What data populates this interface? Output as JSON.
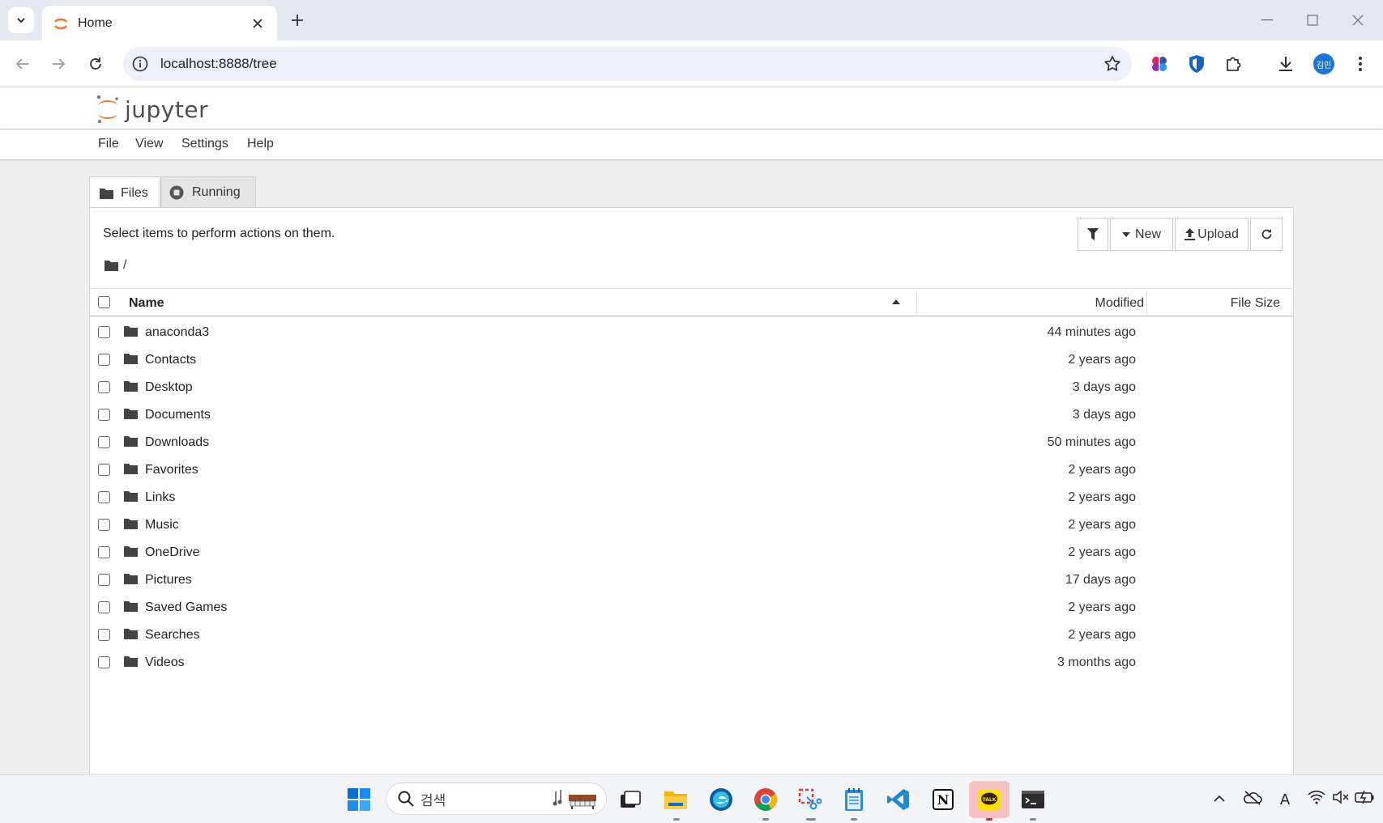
{
  "browser": {
    "tab_title": "Home",
    "url": "localhost:8888/tree",
    "profile_label": "김민"
  },
  "jupyter": {
    "logo_text": "jupyter",
    "menu": [
      "File",
      "View",
      "Settings",
      "Help"
    ],
    "tabs": [
      {
        "label": "Files",
        "icon": "folder-icon",
        "active": true
      },
      {
        "label": "Running",
        "icon": "stop-circle-icon",
        "active": false
      }
    ],
    "hint": "Select items to perform actions on them.",
    "buttons": {
      "filter_icon": "filter-icon",
      "new_label": "New",
      "upload_label": "Upload",
      "refresh_icon": "refresh-icon"
    },
    "breadcrumb": "/",
    "columns": {
      "name": "Name",
      "modified": "Modified",
      "size": "File Size"
    },
    "files": [
      {
        "name": "anaconda3",
        "modified": "44 minutes ago"
      },
      {
        "name": "Contacts",
        "modified": "2 years ago"
      },
      {
        "name": "Desktop",
        "modified": "3 days ago"
      },
      {
        "name": "Documents",
        "modified": "3 days ago"
      },
      {
        "name": "Downloads",
        "modified": "50 minutes ago"
      },
      {
        "name": "Favorites",
        "modified": "2 years ago"
      },
      {
        "name": "Links",
        "modified": "2 years ago"
      },
      {
        "name": "Music",
        "modified": "2 years ago"
      },
      {
        "name": "OneDrive",
        "modified": "2 years ago"
      },
      {
        "name": "Pictures",
        "modified": "17 days ago"
      },
      {
        "name": "Saved Games",
        "modified": "2 years ago"
      },
      {
        "name": "Searches",
        "modified": "2 years ago"
      },
      {
        "name": "Videos",
        "modified": "3 months ago"
      }
    ]
  },
  "taskbar": {
    "search_placeholder": "검색",
    "apps": [
      "start-icon",
      "task-view-icon",
      "file-explorer-icon",
      "edge-icon",
      "chrome-icon",
      "snipping-tool-icon",
      "notepad-icon",
      "vscode-icon",
      "notion-icon",
      "kakaotalk-icon",
      "terminal-icon"
    ],
    "kakaotalk_badge": "TALK",
    "notion_letter": "N",
    "ime_label": "A"
  },
  "colors": {
    "jupyter_orange": "#f37726",
    "accent_blue": "#1a73e8",
    "panel_bg": "#eeeeee"
  }
}
